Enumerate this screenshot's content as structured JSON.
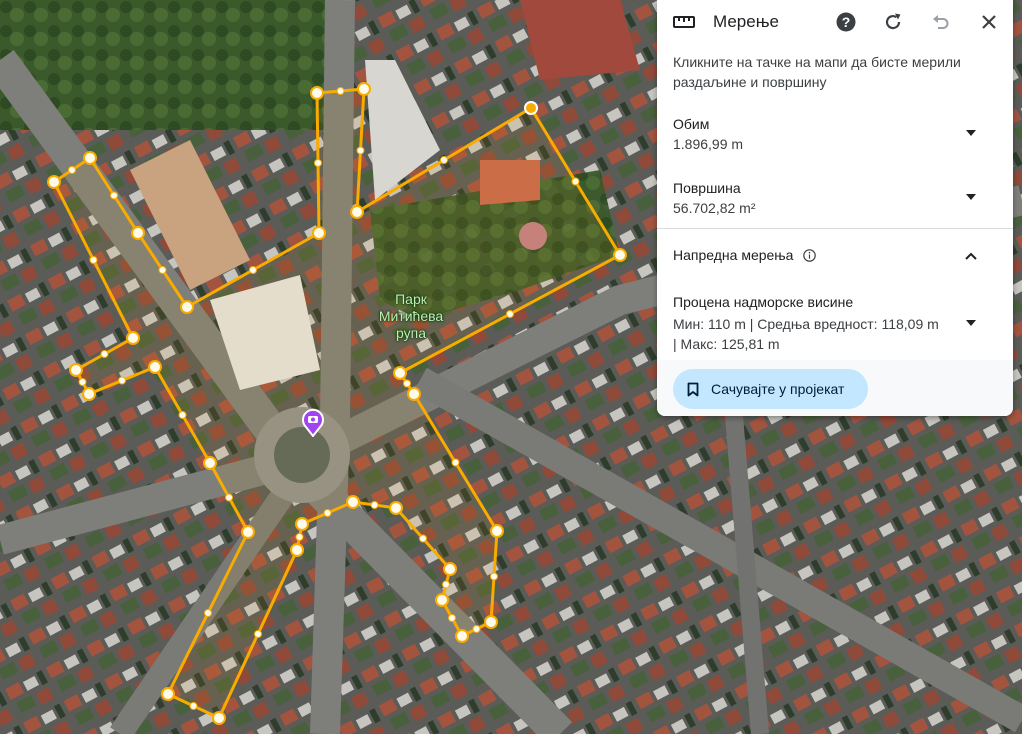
{
  "map": {
    "park_label": "Парк Митићева рупа"
  },
  "panel": {
    "title": "Мерење",
    "icons": {
      "ruler": "ruler-icon",
      "help": "help-icon",
      "refresh": "refresh-icon",
      "undo": "undo-icon",
      "close": "close-icon"
    },
    "description": "Кликните на тачке на мапи да бисте мерили раздаљине и површину",
    "perimeter": {
      "label": "Обим",
      "value": "1.896,99 m"
    },
    "area": {
      "label": "Површина",
      "value": "56.702,82 m²"
    },
    "advanced": {
      "label": "Напредна мерења"
    },
    "elevation": {
      "label": "Процена надморске висине",
      "value": "Мин: 110 m | Средња вредност: 118,09 m | Макс: 125,81 m"
    },
    "save_button": "Сачувајте у пројекат"
  },
  "colors": {
    "accent": "#f9ab00",
    "button_bg": "#c2e7ff",
    "pin": "#a142f4"
  }
}
